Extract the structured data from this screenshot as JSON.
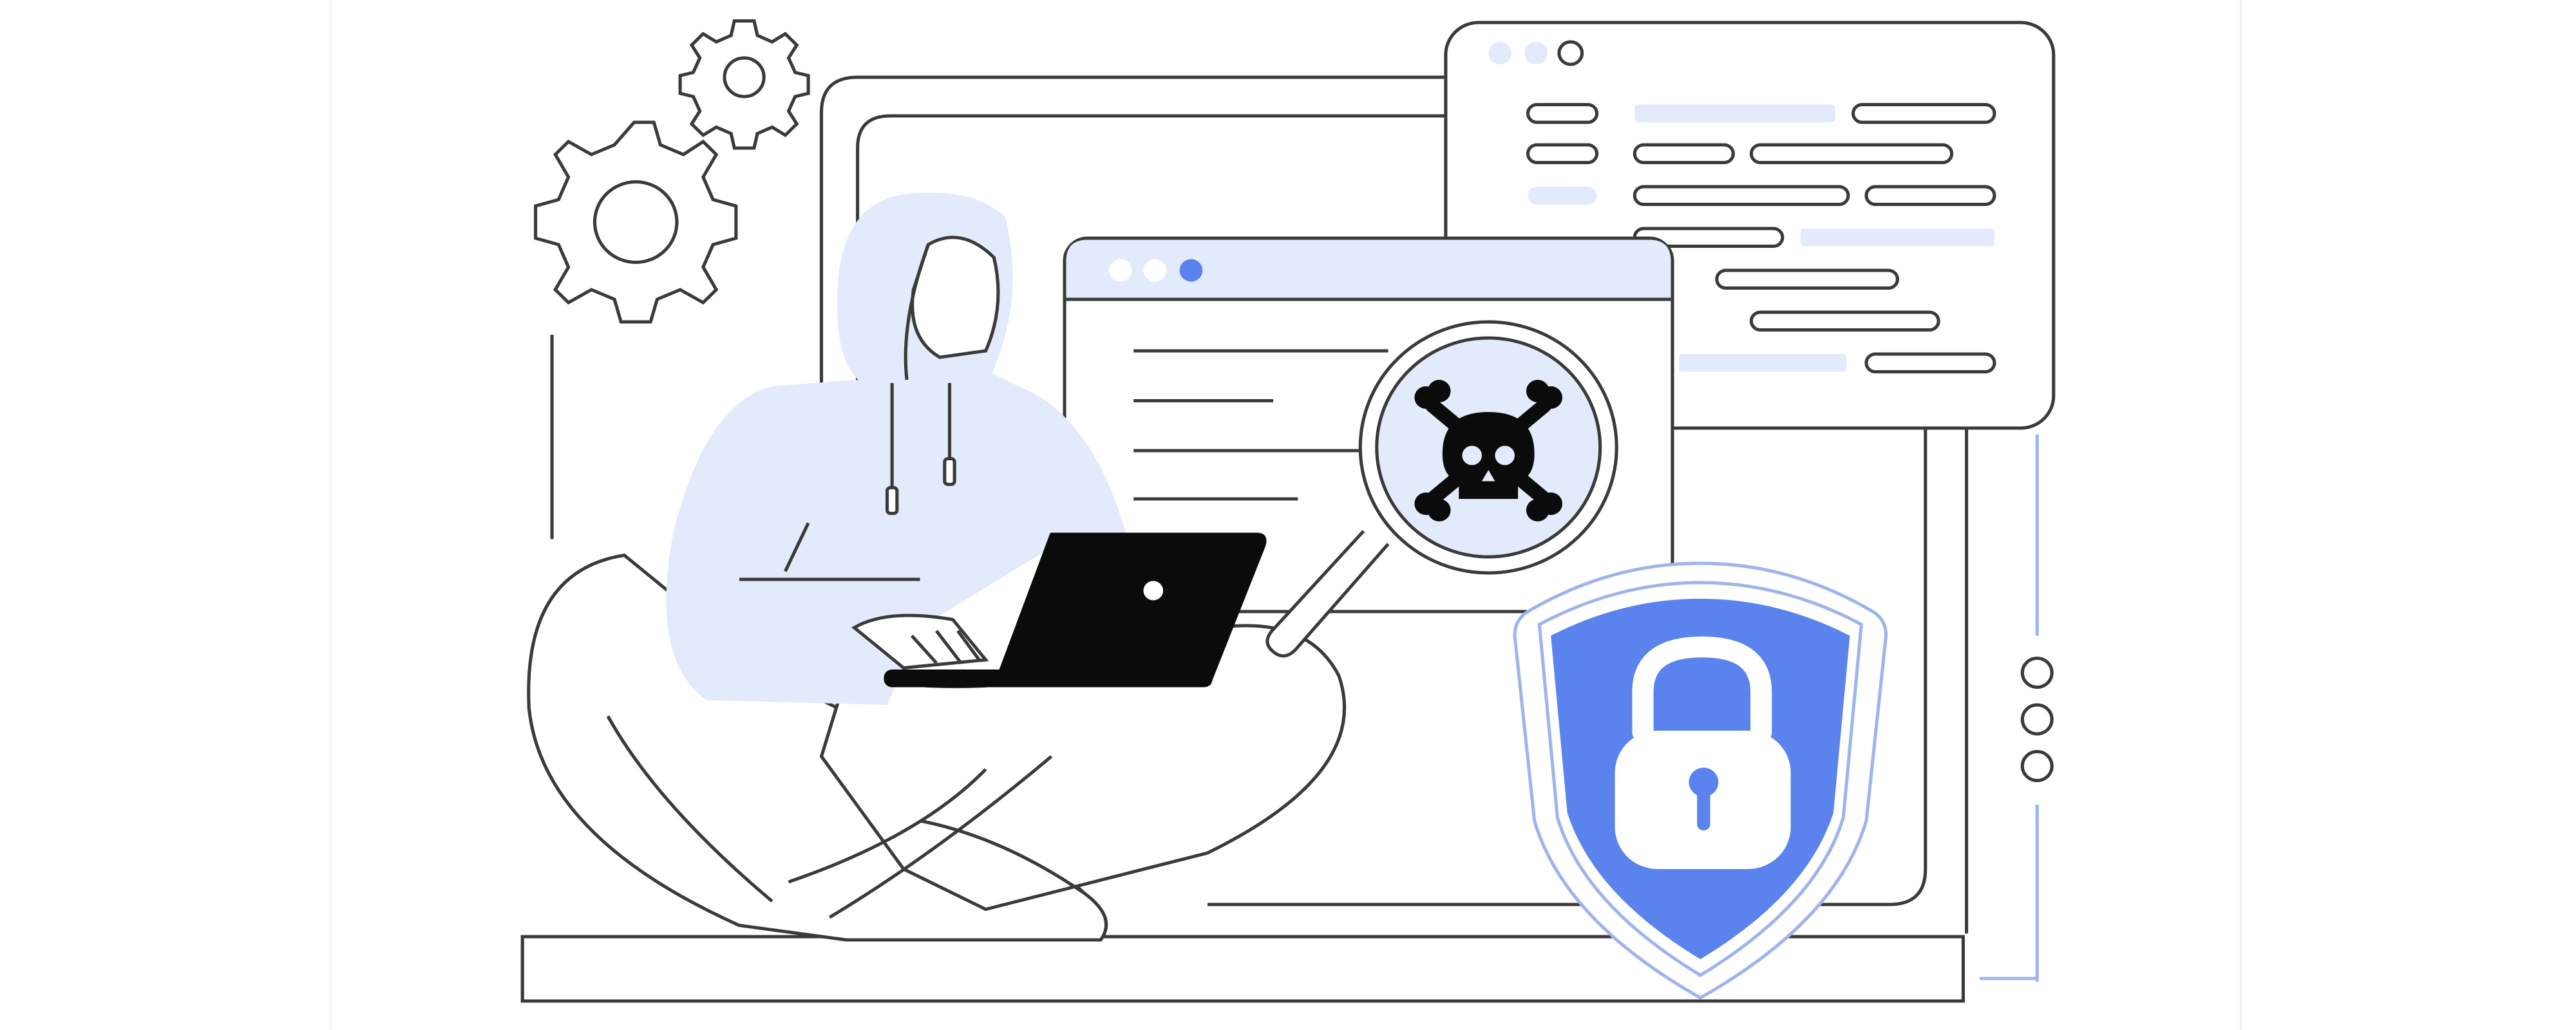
{
  "illustration": {
    "colors": {
      "stroke": "#3a3a3a",
      "light_blue": "#e3eafb",
      "accent_blue": "#5a83ee",
      "black": "#0b0b0b",
      "white": "#ffffff"
    },
    "elements": {
      "gears": [
        "gear-icon",
        "gear-icon"
      ],
      "hooded_figure": "hacker-figure",
      "laptop": "laptop-icon",
      "browser_window": "browser-window",
      "code_panel": "code-panel",
      "magnifier": "magnifier-icon",
      "threat_symbol": "skull-crossbones-icon",
      "security_badge": "shield-lock-icon"
    }
  }
}
